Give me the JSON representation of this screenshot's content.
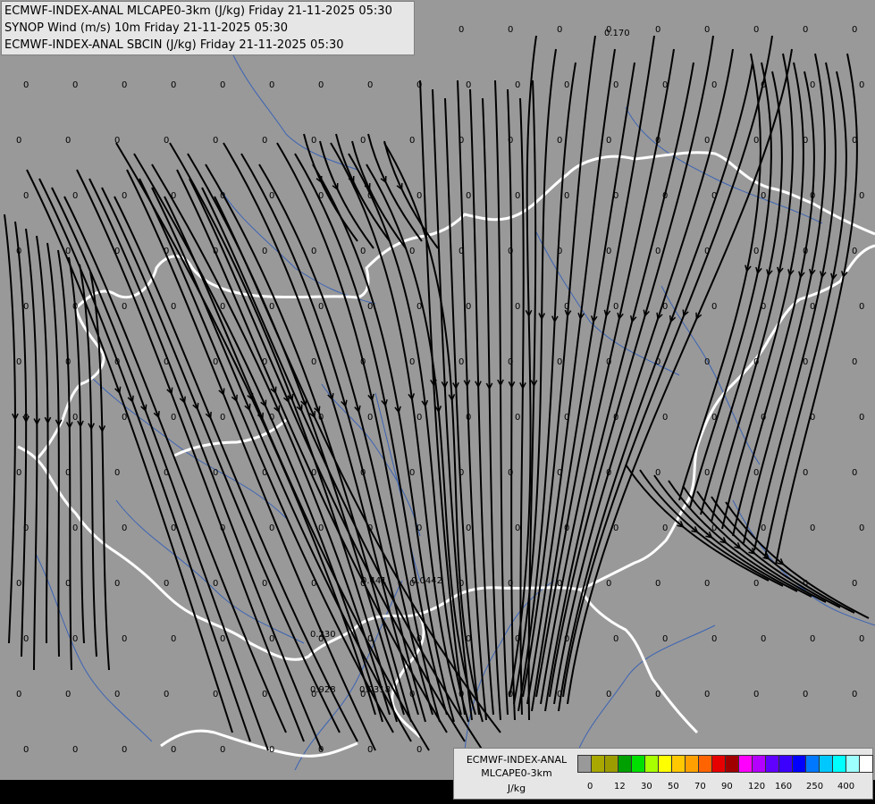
{
  "header": {
    "line1": "ECMWF-INDEX-ANAL MLCAPE0-3km (J/kg) Friday 21-11-2025 05:30",
    "line2": "SYNOP Wind (m/s) 10m Friday 21-11-2025 05:30",
    "line3": "ECMWF-INDEX-ANAL SBCIN (J/kg) Friday 21-11-2025 05:30"
  },
  "legend": {
    "line1": "ECMWF-INDEX-ANAL",
    "line2": "MLCAPE0-3km",
    "unit": "J/kg",
    "colors": [
      "#999999",
      "#a8a800",
      "#9c9c00",
      "#00a000",
      "#00e000",
      "#a8ff00",
      "#ffff00",
      "#ffc800",
      "#ffa000",
      "#ff6400",
      "#e60000",
      "#a00000",
      "#ff00ff",
      "#b400ff",
      "#6000ff",
      "#3c00ff",
      "#0000ff",
      "#0078ff",
      "#00c8ff",
      "#00ffff",
      "#9effff",
      "#ffffff"
    ],
    "ticks": [
      "0",
      "12",
      "30",
      "50",
      "70",
      "90",
      "120",
      "160",
      "250",
      "400"
    ]
  },
  "map_values": {
    "nonzero": [
      "0.170",
      "0.441",
      "0.0442",
      "0.230",
      "0.928",
      "0.0318"
    ],
    "zero_label": "0"
  },
  "colors": {
    "background": "#999999",
    "border": "#ffffff",
    "rivers": "#3c64b4",
    "streamlines": "#000000"
  }
}
